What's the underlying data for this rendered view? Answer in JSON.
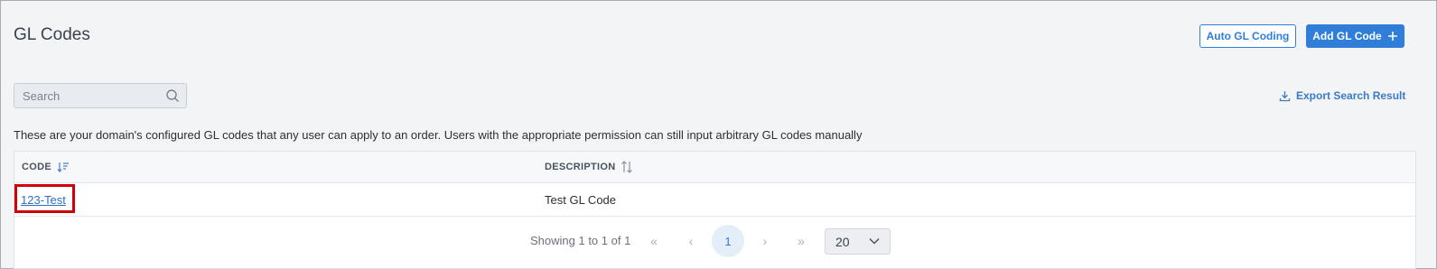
{
  "page": {
    "title": "GL Codes"
  },
  "actions": {
    "auto_gl_coding": "Auto GL Coding",
    "add_gl_code": "Add GL Code",
    "add_icon": "plus-icon"
  },
  "search": {
    "placeholder": "Search",
    "value": "",
    "icon": "search-icon"
  },
  "export": {
    "label": "Export Search Result",
    "icon": "download-icon"
  },
  "description": "These are your domain's configured GL codes that any user can apply to an order. Users with the appropriate permission can still input arbitrary GL codes manually",
  "table": {
    "columns": [
      {
        "label": "CODE",
        "sort_icon": "sort-descending-icon"
      },
      {
        "label": "DESCRIPTION",
        "sort_icon": "sort-icon"
      }
    ],
    "rows": [
      {
        "code": "123-Test",
        "description": "Test GL Code"
      }
    ]
  },
  "pagination": {
    "summary": "Showing 1 to 1 of 1",
    "first": "«",
    "prev": "‹",
    "current_page": "1",
    "next": "›",
    "last": "»",
    "per_page": "20"
  },
  "colors": {
    "accent": "#2f7ed8",
    "highlight": "#d0000b",
    "background": "#f3f4f6"
  }
}
